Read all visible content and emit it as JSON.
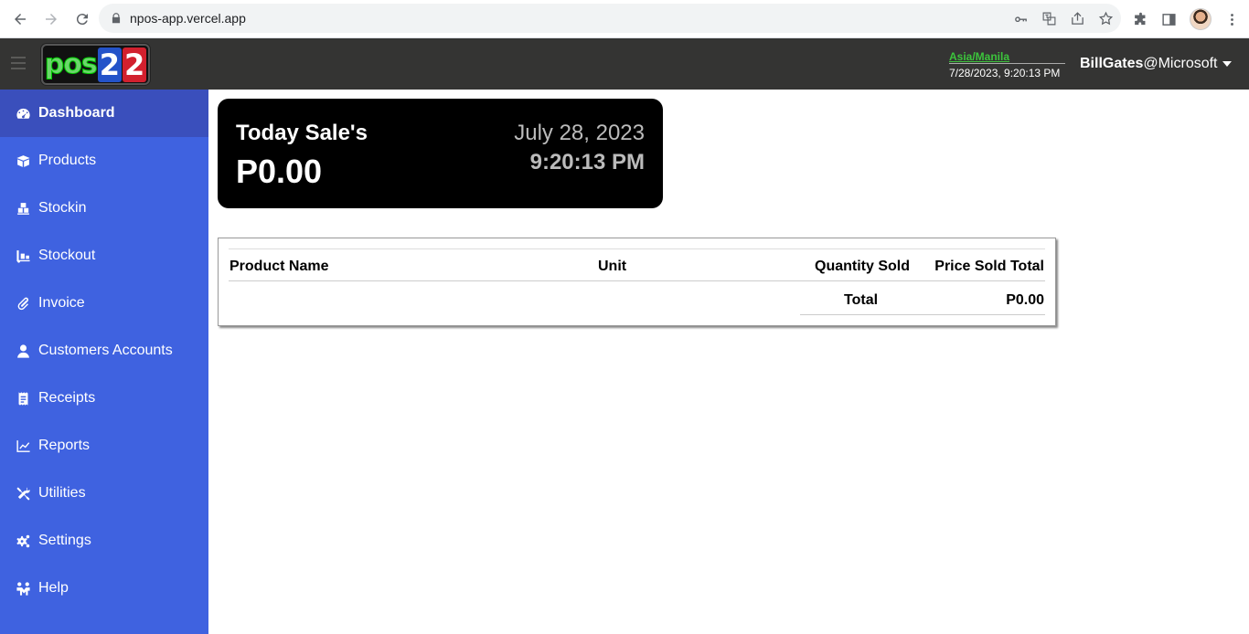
{
  "browser": {
    "url": "npos-app.vercel.app"
  },
  "header": {
    "logo_text": "pos22",
    "timezone": "Asia/Manila",
    "datetime": "7/28/2023, 9:20:13 PM",
    "user_name": "BillGates",
    "user_org": "@Microsoft"
  },
  "sidebar": {
    "items": [
      {
        "label": "Dashboard",
        "icon": "dashboard-icon",
        "active": true
      },
      {
        "label": "Products",
        "icon": "products-box-icon"
      },
      {
        "label": "Stockin",
        "icon": "dolly-boxes-icon"
      },
      {
        "label": "Stockout",
        "icon": "truck-loading-icon"
      },
      {
        "label": "Invoice",
        "icon": "paperclip-icon"
      },
      {
        "label": "Customers Accounts",
        "icon": "user-icon"
      },
      {
        "label": "Receipts",
        "icon": "receipt-icon"
      },
      {
        "label": "Reports",
        "icon": "chart-line-icon"
      },
      {
        "label": "Utilities",
        "icon": "tools-icon"
      },
      {
        "label": "Settings",
        "icon": "cogs-icon"
      },
      {
        "label": "Help",
        "icon": "people-help-icon"
      }
    ]
  },
  "sales_card": {
    "title": "Today Sale's",
    "amount": "P0.00",
    "date": "July 28, 2023",
    "time": "9:20:13 PM"
  },
  "sales_table": {
    "headers": [
      "Product Name",
      "Unit",
      "Quantity Sold",
      "Price Sold Total"
    ],
    "rows": [],
    "total_label": "Total",
    "total_value": "P0.00"
  },
  "colors": {
    "sidebar": "#3f62e0",
    "sidebar_active": "#3a4fbc",
    "header": "#343433",
    "timezone": "#3cc43c"
  }
}
